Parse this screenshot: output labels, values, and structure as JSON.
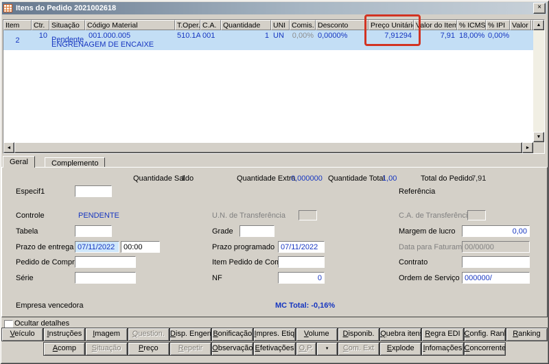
{
  "window": {
    "title": "Itens do Pedido 2021002618"
  },
  "icons": {
    "close": "×",
    "up_arrow": "▲",
    "down_arrow": "▼",
    "left_arrow": "◄",
    "right_arrow": "►",
    "dropdown_arrow": "▼"
  },
  "colors": {
    "window_bg": "#d4d0c8",
    "value_blue": "#1535c0",
    "selected_row_bg": "#c3def5",
    "annotation_red": "#d23322",
    "focused_input_bg": "#cfe7fb"
  },
  "annotation": {
    "highlight_target": "Preço Unitário"
  },
  "grid": {
    "columns": [
      "Item",
      "Ctr.",
      "Situação",
      "Código Material",
      "T.Oper.",
      "C.A.",
      "Quantidade",
      "UNI",
      "Comis.",
      "Desconto",
      "Preço Unitário",
      "Valor do Item",
      "% ICMS",
      "% IPI",
      "Valor IPI"
    ],
    "row": {
      "item": "2",
      "ctr": "10",
      "situacao": "Pendente",
      "codigo_material": "001.000.005",
      "t_oper": "510.1A",
      "ca": "001",
      "quantidade": "1",
      "uni": "UN",
      "comis": "0,00%",
      "desconto": "0,0000%",
      "preco_unitario": "7,91294",
      "valor_item": "7,91",
      "icms": "18,00%",
      "ipi": "0,00%",
      "valor_ipi": "",
      "descricao": "ENGRENAGEM DE ENCAIXE"
    }
  },
  "tabs": {
    "geral": "Geral",
    "complemento": "Complemento"
  },
  "form": {
    "quantidade_saldo": {
      "label": "Quantidade Saldo",
      "value": "1"
    },
    "quantidade_extra": {
      "label": "Quantidade Extra",
      "value": "0,000000"
    },
    "quantidade_total": {
      "label": "Quantidade Total",
      "value": "1,00"
    },
    "total_pedido": {
      "label": "Total do Pedido",
      "value": "7,91"
    },
    "especif1": {
      "label": "Especif1",
      "value": ""
    },
    "referencia": {
      "label": "Referência"
    },
    "controle": {
      "label": "Controle",
      "value": "PENDENTE"
    },
    "un_transferencia": {
      "label": "U.N. de Transferência",
      "value": ""
    },
    "ca_transferencia": {
      "label": "C.A. de Transferência",
      "value": ""
    },
    "tabela": {
      "label": "Tabela",
      "value": ""
    },
    "grade": {
      "label": "Grade",
      "value": ""
    },
    "margem_lucro": {
      "label": "Margem de lucro",
      "value": "0,00"
    },
    "prazo_entrega": {
      "label": "Prazo de entrega",
      "value": "07/11/2022",
      "hora": "00:00"
    },
    "prazo_programado": {
      "label": "Prazo programado",
      "value": "07/11/2022"
    },
    "data_faturamento": {
      "label": "Data para Faturamento",
      "value": "00/00/00"
    },
    "pedido_compra": {
      "label": "Pedido de Compra",
      "value": ""
    },
    "item_pedido_compra": {
      "label": "Item Pedido de Compra",
      "value": ""
    },
    "contrato": {
      "label": "Contrato",
      "value": ""
    },
    "serie": {
      "label": "Série",
      "value": ""
    },
    "nf": {
      "label": "NF",
      "value": "0"
    },
    "ordem_servico": {
      "label": "Ordem de Serviço",
      "value": "000000/"
    },
    "empresa_vencedora": {
      "label": "Empresa vencedora"
    },
    "mc_total": "MC Total: -0,16%"
  },
  "ocultar_detalhes": "Ocultar detalhes",
  "buttons": {
    "row1": [
      {
        "label": "Veículo"
      },
      {
        "label": "Instruções"
      },
      {
        "label": "Imagem"
      },
      {
        "label": "Question.",
        "disabled": true
      },
      {
        "label": "Disp. Engenh."
      },
      {
        "label": "Bonificação"
      },
      {
        "label": "Impres. Etiq."
      },
      {
        "label": "Volume"
      },
      {
        "label": "Disponib."
      },
      {
        "label": "Quebra itens"
      },
      {
        "label": "Regra EDI"
      },
      {
        "label": "Config. Rank."
      },
      {
        "label": "Ranking"
      }
    ],
    "row2": [
      {
        "label": "Acomp"
      },
      {
        "label": "Situação",
        "disabled": true
      },
      {
        "label": "Preço"
      },
      {
        "label": "Repetir",
        "disabled": true
      },
      {
        "label": "Observação"
      },
      {
        "label": "Efetivações"
      },
      {
        "label": "O.P.",
        "disabled": true
      },
      {
        "label": "Com. Ext",
        "disabled": true
      },
      {
        "label": "Explode"
      },
      {
        "label": "Infomações"
      },
      {
        "label": "Concorrente"
      }
    ]
  }
}
